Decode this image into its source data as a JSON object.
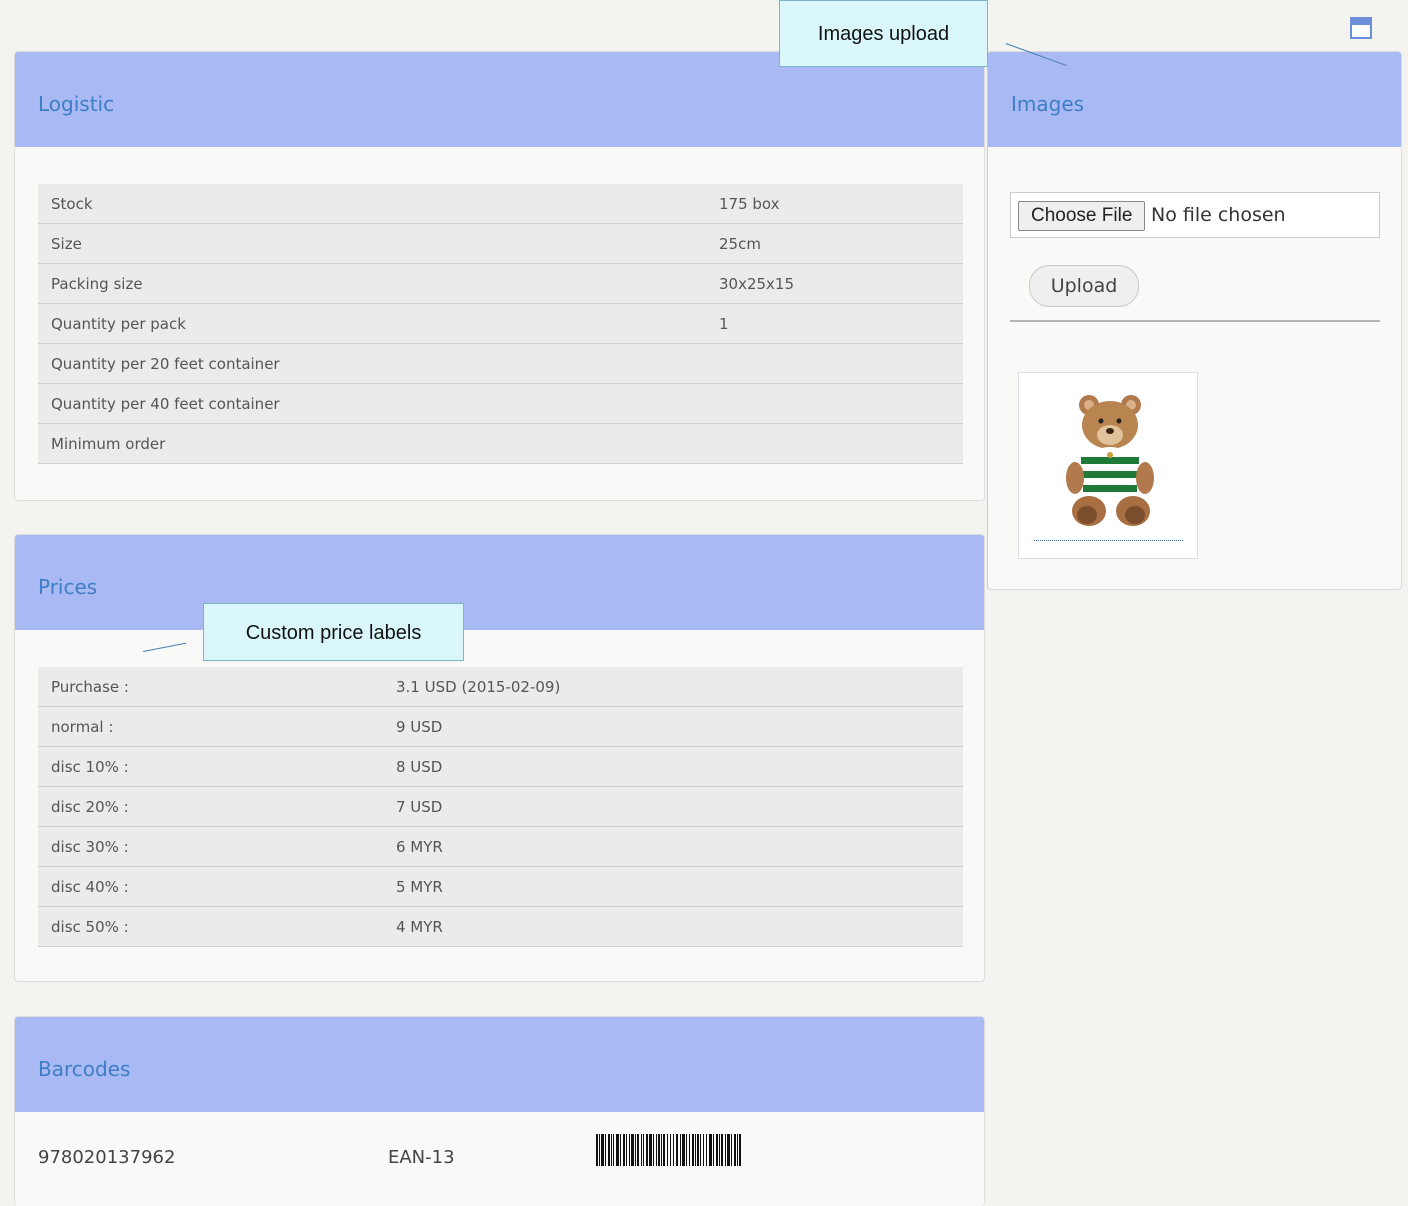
{
  "logistic": {
    "title": "Logistic",
    "rows": [
      {
        "label": "Stock",
        "value": "175 box"
      },
      {
        "label": "Size",
        "value": "25cm"
      },
      {
        "label": "Packing size",
        "value": "30x25x15"
      },
      {
        "label": "Quantity per pack",
        "value": "1"
      },
      {
        "label": "Quantity per 20 feet container",
        "value": ""
      },
      {
        "label": "Quantity per 40 feet container",
        "value": ""
      },
      {
        "label": "Minimum order",
        "value": ""
      }
    ]
  },
  "prices": {
    "title": "Prices",
    "rows": [
      {
        "label": "Purchase :",
        "value": "3.1 USD (2015-02-09)"
      },
      {
        "label": "normal :",
        "value": "9 USD"
      },
      {
        "label": "disc 10% :",
        "value": "8 USD"
      },
      {
        "label": "disc 20% :",
        "value": "7 USD"
      },
      {
        "label": "disc 30% :",
        "value": "6 MYR"
      },
      {
        "label": "disc 40% :",
        "value": "5 MYR"
      },
      {
        "label": "disc 50% :",
        "value": "4 MYR"
      }
    ]
  },
  "barcodes": {
    "title": "Barcodes",
    "items": [
      {
        "number": "978020137962",
        "type": "EAN-13"
      }
    ]
  },
  "images": {
    "title": "Images",
    "choose_file_label": "Choose File",
    "file_status": "No file chosen",
    "upload_label": "Upload"
  },
  "callouts": {
    "images_upload": "Images upload",
    "custom_price_labels": "Custom price labels"
  },
  "colors": {
    "panel_header": "#a8b9f3",
    "title_text": "#3f7ec5",
    "callout_bg": "#d9f7fb"
  },
  "icons": [
    "window-layout-icon",
    "barcode-image",
    "teddy-bear-thumbnail"
  ]
}
